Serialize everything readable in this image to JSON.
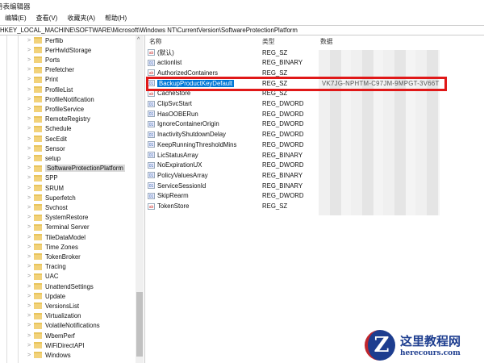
{
  "window": {
    "title": "册表编辑器"
  },
  "menu": [
    "编辑(E)",
    "查看(V)",
    "收藏夹(A)",
    "帮助(H)"
  ],
  "address": "HKEY_LOCAL_MACHINE\\SOFTWARE\\Microsoft\\Windows NT\\CurrentVersion\\SoftwareProtectionPlatform",
  "tree": [
    "Perflib",
    "PerHwIdStorage",
    "Ports",
    "Prefetcher",
    "Print",
    "ProfileList",
    "ProfileNotification",
    "ProfileService",
    "RemoteRegistry",
    "Schedule",
    "SecEdit",
    "Sensor",
    "setup",
    "SoftwareProtectionPlatform",
    "SPP",
    "SRUM",
    "Superfetch",
    "Svchost",
    "SystemRestore",
    "Terminal Server",
    "TileDataModel",
    "Time Zones",
    "TokenBroker",
    "Tracing",
    "UAC",
    "UnattendSettings",
    "Update",
    "VersionsList",
    "Virtualization",
    "VolatileNotifications",
    "WbemPerf",
    "WiFiDirectAPI",
    "Windows"
  ],
  "tree_selected": "SoftwareProtectionPlatform",
  "columns": {
    "name": "名称",
    "type": "类型",
    "data": "数据"
  },
  "values": [
    {
      "name": "(默认)",
      "type": "REG_SZ",
      "icon": "sz",
      "data": ""
    },
    {
      "name": "actionlist",
      "type": "REG_BINARY",
      "icon": "bin",
      "data": ""
    },
    {
      "name": "AuthorizedContainers",
      "type": "REG_SZ",
      "icon": "sz",
      "data": ""
    },
    {
      "name": "BackupProductKeyDefault",
      "type": "REG_SZ",
      "icon": "bin",
      "data": "VK7JG-NPHTM-C97JM-9MPGT-3V66T"
    },
    {
      "name": "CacheStore",
      "type": "REG_SZ",
      "icon": "sz",
      "data": ""
    },
    {
      "name": "ClipSvcStart",
      "type": "REG_DWORD",
      "icon": "bin",
      "data": ""
    },
    {
      "name": "HasOOBERun",
      "type": "REG_DWORD",
      "icon": "bin",
      "data": ""
    },
    {
      "name": "IgnoreContainerOrigin",
      "type": "REG_DWORD",
      "icon": "bin",
      "data": ""
    },
    {
      "name": "InactivityShutdownDelay",
      "type": "REG_DWORD",
      "icon": "bin",
      "data": ""
    },
    {
      "name": "KeepRunningThresholdMins",
      "type": "REG_DWORD",
      "icon": "bin",
      "data": ""
    },
    {
      "name": "LicStatusArray",
      "type": "REG_BINARY",
      "icon": "bin",
      "data": ""
    },
    {
      "name": "NoExpirationUX",
      "type": "REG_DWORD",
      "icon": "bin",
      "data": ""
    },
    {
      "name": "PolicyValuesArray",
      "type": "REG_BINARY",
      "icon": "bin",
      "data": ""
    },
    {
      "name": "ServiceSessionId",
      "type": "REG_BINARY",
      "icon": "bin",
      "data": ""
    },
    {
      "name": "SkipRearm",
      "type": "REG_DWORD",
      "icon": "bin",
      "data": ""
    },
    {
      "name": "TokenStore",
      "type": "REG_SZ",
      "icon": "sz",
      "data": ""
    }
  ],
  "selected_value": "BackupProductKeyDefault",
  "watermark": {
    "name": "这里教程网",
    "url": "herecours.com"
  }
}
